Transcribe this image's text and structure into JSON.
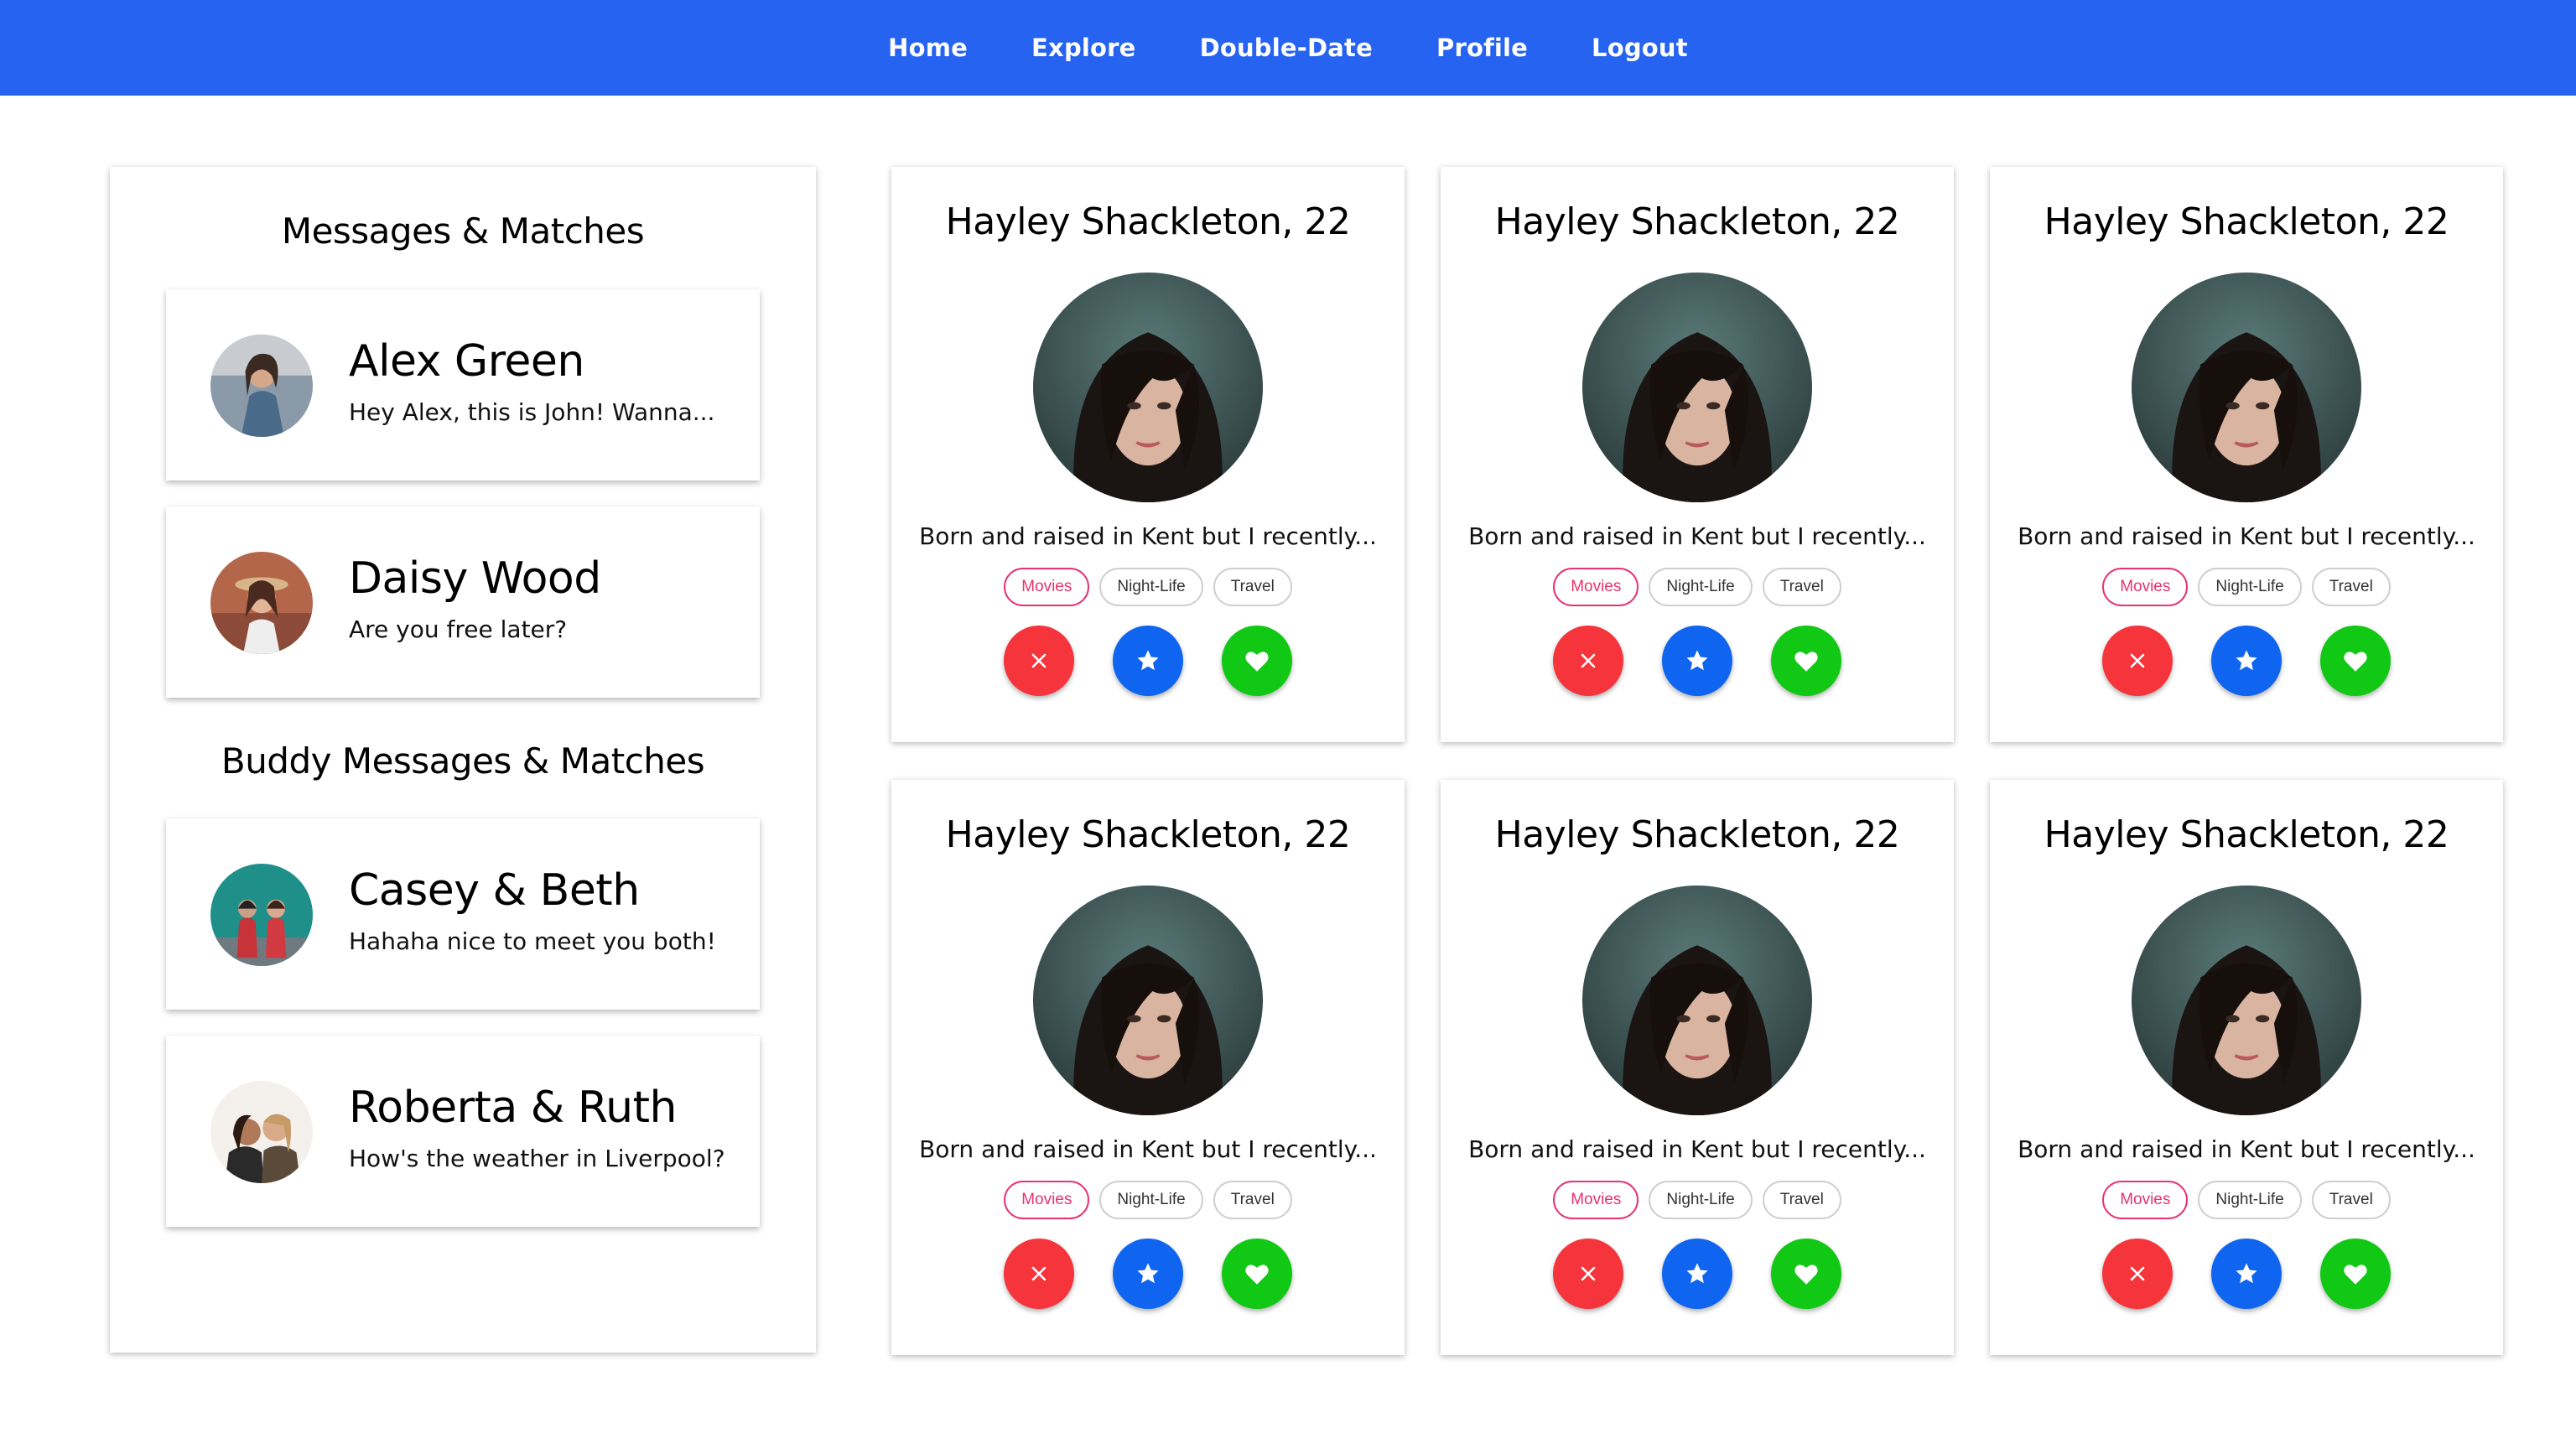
{
  "nav": {
    "items": [
      "Home",
      "Explore",
      "Double-Date",
      "Profile",
      "Logout"
    ]
  },
  "sidebar": {
    "heading": "Messages & Matches",
    "messages": [
      {
        "name": "Alex Green",
        "preview": "Hey Alex, this is John! Wanna..."
      },
      {
        "name": "Daisy Wood",
        "preview": "Are you free later?"
      }
    ],
    "buddy_heading": "Buddy Messages & Matches",
    "buddy_messages": [
      {
        "name": "Casey & Beth",
        "preview": "Hahaha nice to meet you both!"
      },
      {
        "name": "Roberta & Ruth",
        "preview": "How's the weather in Liverpool?"
      }
    ]
  },
  "cards": [
    {
      "name": "Hayley Shackleton, 22",
      "bio": "Born and raised in Kent but I recently...",
      "tags": [
        "Movies",
        "Night-Life",
        "Travel"
      ]
    },
    {
      "name": "Hayley Shackleton, 22",
      "bio": "Born and raised in Kent but I recently...",
      "tags": [
        "Movies",
        "Night-Life",
        "Travel"
      ]
    },
    {
      "name": "Hayley Shackleton, 22",
      "bio": "Born and raised in Kent but I recently...",
      "tags": [
        "Movies",
        "Night-Life",
        "Travel"
      ]
    },
    {
      "name": "Hayley Shackleton, 22",
      "bio": "Born and raised in Kent but I recently...",
      "tags": [
        "Movies",
        "Night-Life",
        "Travel"
      ]
    },
    {
      "name": "Hayley Shackleton, 22",
      "bio": "Born and raised in Kent but I recently...",
      "tags": [
        "Movies",
        "Night-Life",
        "Travel"
      ]
    },
    {
      "name": "Hayley Shackleton, 22",
      "bio": "Born and raised in Kent but I recently...",
      "tags": [
        "Movies",
        "Night-Life",
        "Travel"
      ]
    }
  ],
  "colors": {
    "nav": "#2563f0",
    "tag_active": "#e8336b",
    "reject": "#f5343c",
    "star": "#0f64f0",
    "like": "#11c814"
  },
  "icons": {
    "reject": "close-icon",
    "star": "star-icon",
    "like": "heart-icon"
  }
}
